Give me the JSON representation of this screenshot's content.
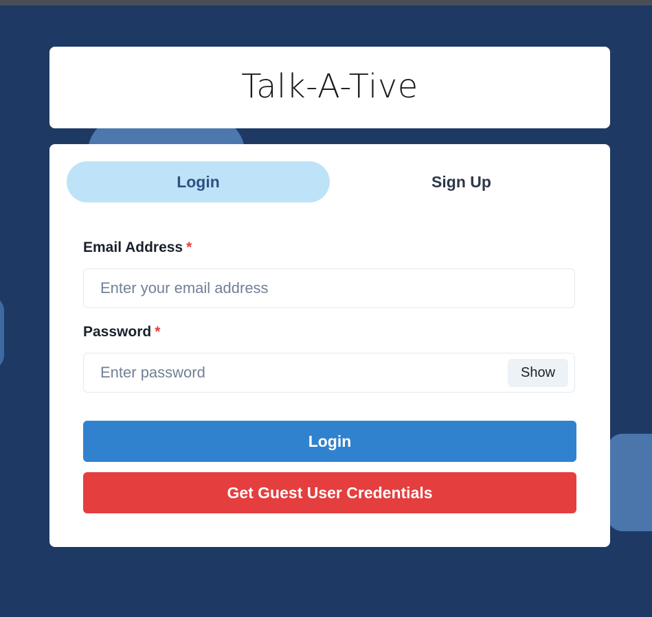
{
  "app": {
    "title": "Talk-A-Tive"
  },
  "tabs": [
    {
      "label": "Login",
      "active": true
    },
    {
      "label": "Sign Up",
      "active": false
    }
  ],
  "form": {
    "email": {
      "label": "Email Address",
      "required_mark": "*",
      "placeholder": "Enter your email address",
      "value": ""
    },
    "password": {
      "label": "Password",
      "required_mark": "*",
      "placeholder": "Enter password",
      "value": "",
      "toggle_label": "Show"
    },
    "login_button": "Login",
    "guest_button": "Get Guest User Credentials"
  },
  "colors": {
    "background": "#1e3a64",
    "active_tab": "#bee3f8",
    "login_button": "#3182ce",
    "guest_button": "#e53e3e",
    "required": "#e53e3e"
  }
}
